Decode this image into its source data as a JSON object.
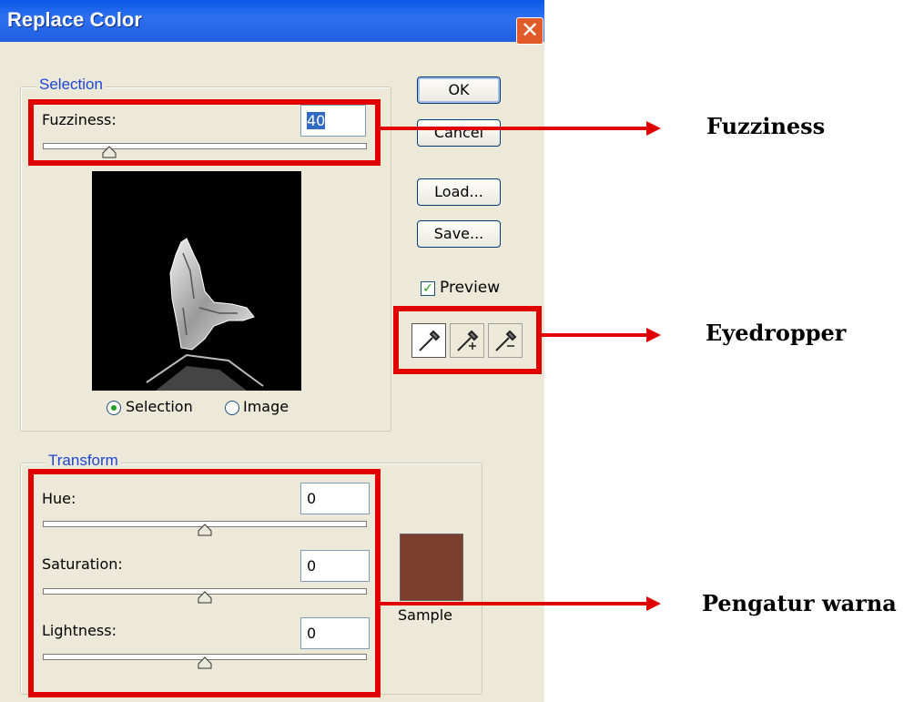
{
  "window": {
    "title": "Replace Color",
    "close_glyph": "✕"
  },
  "selection": {
    "legend": "Selection",
    "fuzziness_label": "Fuzziness:",
    "fuzziness_value": "40",
    "fuzziness_level": 0.2,
    "radio_selection": "Selection",
    "radio_image": "Image",
    "selected_view": "Selection"
  },
  "buttons": {
    "ok": "OK",
    "cancel": "Cancel",
    "load": "Load...",
    "save": "Save..."
  },
  "preview_checkbox": {
    "label": "Preview",
    "checked": true
  },
  "eyedroppers": [
    "eyedropper-icon",
    "eyedropper-plus-icon",
    "eyedropper-minus-icon"
  ],
  "transform": {
    "legend": "Transform",
    "hue_label": "Hue:",
    "hue_value": "0",
    "saturation_label": "Saturation:",
    "saturation_value": "0",
    "lightness_label": "Lightness:",
    "lightness_value": "0",
    "sample_label": "Sample",
    "sample_color": "#7b3f2e"
  },
  "annotations": {
    "fuzziness": "Fuzziness",
    "eyedropper": "Eyedropper",
    "color": "Pengatur warna"
  },
  "colors": {
    "highlight": "#e00000",
    "legend_text": "#1c45d8",
    "dialog_bg": "#ece9d8",
    "title_bar": "#0a58e8"
  }
}
